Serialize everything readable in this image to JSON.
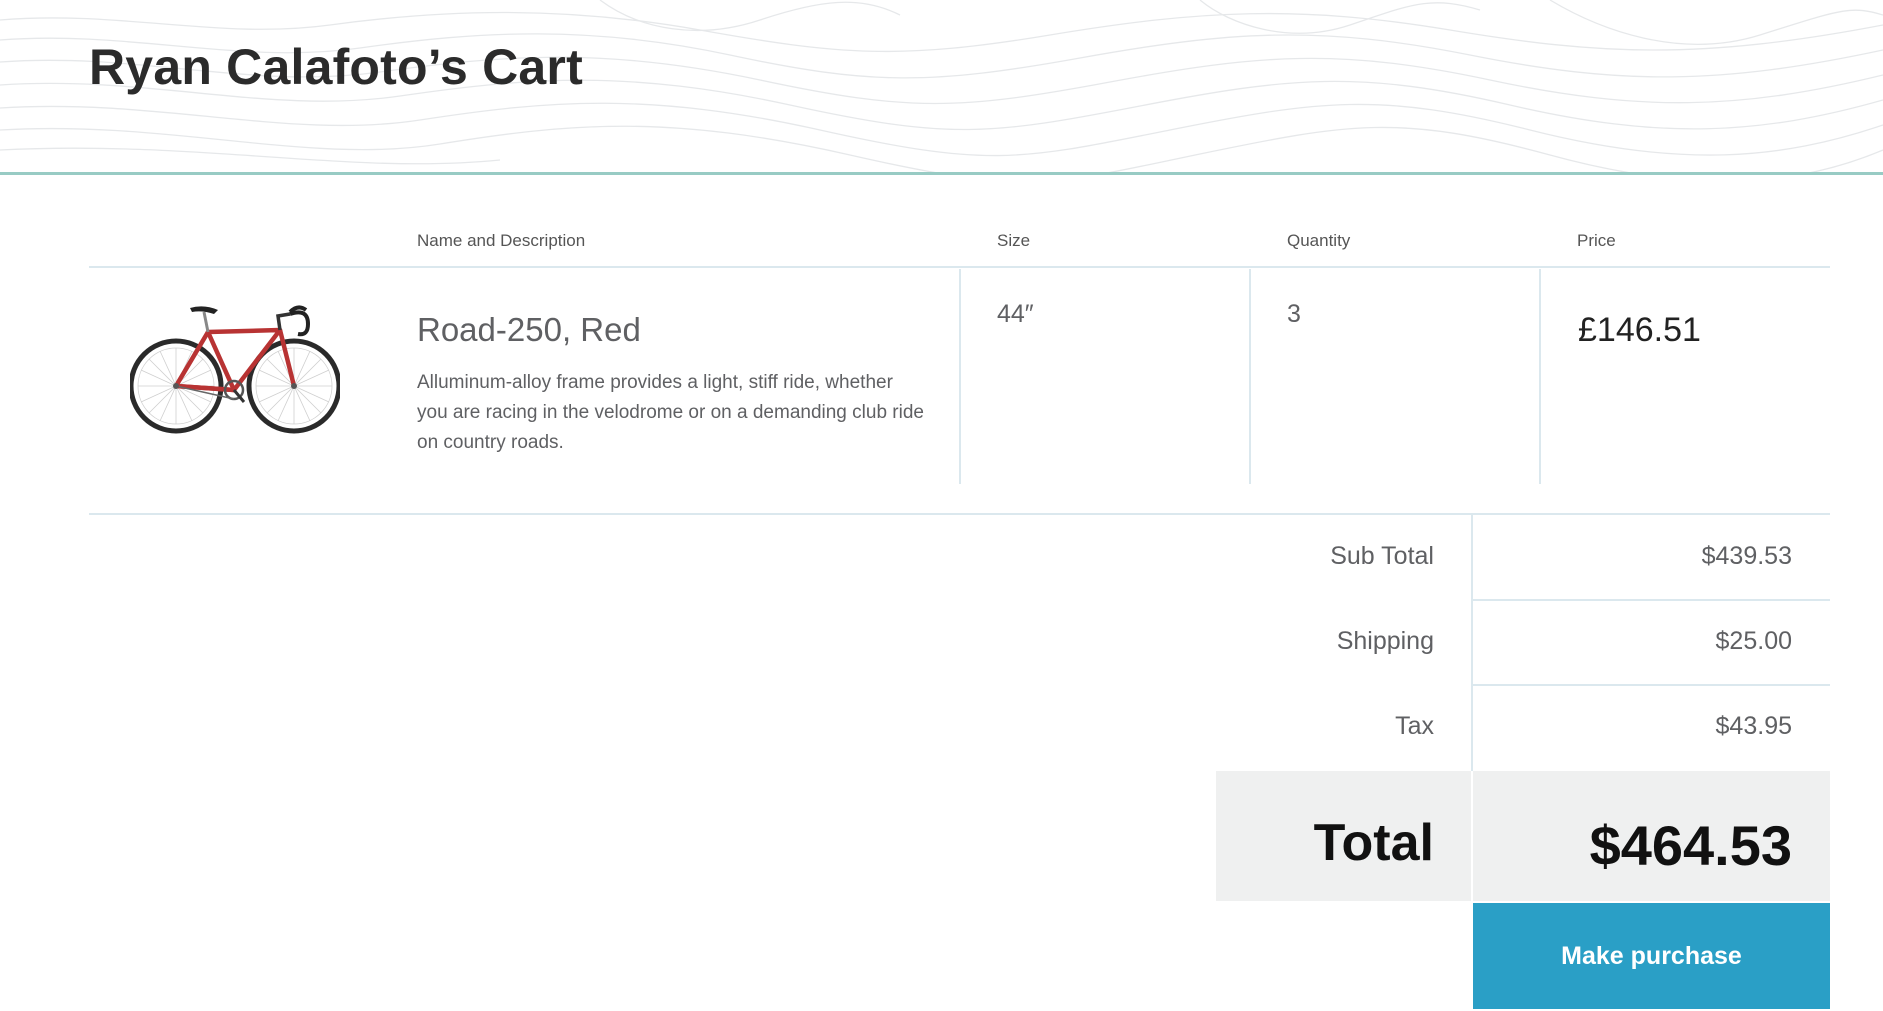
{
  "page_title": "Ryan Calafoto’s Cart",
  "columns": {
    "name_description": "Name and Description",
    "size": "Size",
    "quantity": "Quantity",
    "price": "Price"
  },
  "items": [
    {
      "image_icon": "bicycle-image",
      "name": "Road-250, Red",
      "description": "Alluminum-alloy frame provides a light, stiff ride, whether you are racing in the velodrome or on a demanding club ride on country roads.",
      "size": "44″",
      "quantity": "3",
      "price": "£146.51"
    }
  ],
  "summary": {
    "sub_total_label": "Sub Total",
    "sub_total_value": "$439.53",
    "shipping_label": "Shipping",
    "shipping_value": "$25.00",
    "tax_label": "Tax",
    "tax_value": "$43.95",
    "total_label": "Total",
    "total_value": "$464.53"
  },
  "actions": {
    "purchase_label": "Make purchase"
  },
  "colors": {
    "accent_rule": "#98cbc4",
    "button": "#2a9fc6",
    "total_bg": "#eff0f0",
    "bike_frame": "#b83333"
  }
}
